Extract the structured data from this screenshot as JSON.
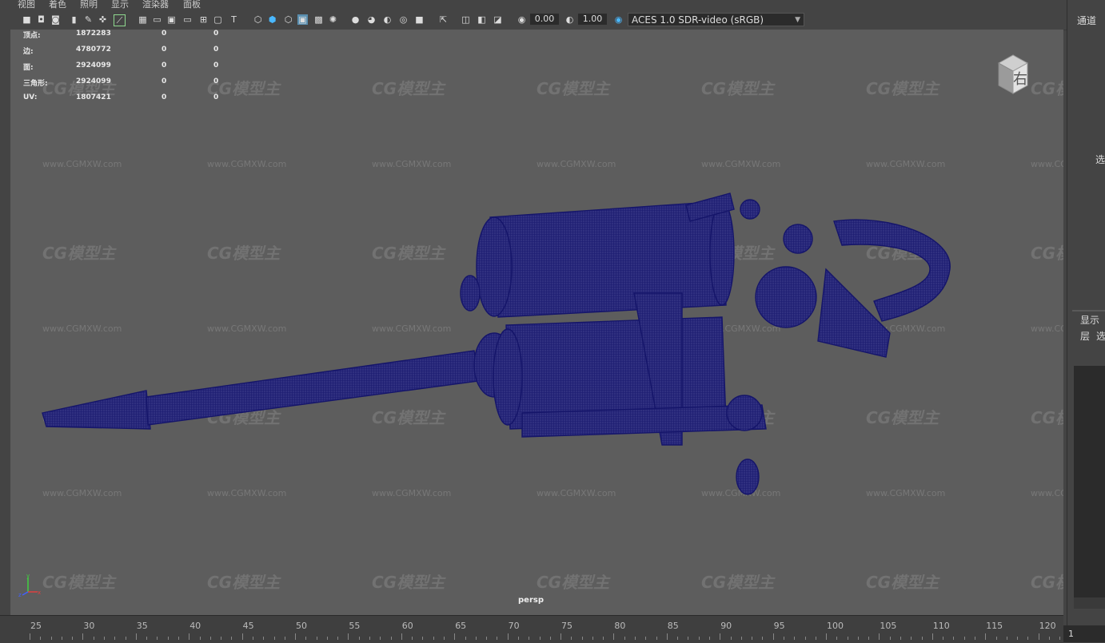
{
  "menu": [
    "视图",
    "着色",
    "照明",
    "显示",
    "渲染器",
    "面板"
  ],
  "toolbar": {
    "exposure_value": "0.00",
    "gamma_value": "1.00",
    "color_space": "ACES 1.0 SDR-video (sRGB)"
  },
  "hud_stats": [
    {
      "label": "顶点:",
      "v1": "1872283",
      "v2": "0",
      "v3": "0"
    },
    {
      "label": "边:",
      "v1": "4780772",
      "v2": "0",
      "v3": "0"
    },
    {
      "label": "面:",
      "v1": "2924099",
      "v2": "0",
      "v3": "0"
    },
    {
      "label": "三角形:",
      "v1": "2924099",
      "v2": "0",
      "v3": "0"
    },
    {
      "label": "UV:",
      "v1": "1807421",
      "v2": "0",
      "v3": "0"
    }
  ],
  "viewcube_label": "右",
  "camera_label": "persp",
  "watermark": {
    "logo": "CG模型主",
    "url": "www.CGMXW.com"
  },
  "right_panel": {
    "tab_channels": "通道",
    "select_label": "选",
    "display_label": "显示",
    "layer_label": "层",
    "sel2": "选"
  },
  "timeline": {
    "ticks": [
      "25",
      "30",
      "35",
      "40",
      "45",
      "50",
      "55",
      "60",
      "65",
      "70",
      "75",
      "80",
      "85",
      "90",
      "95",
      "100",
      "105",
      "110",
      "115",
      "120"
    ],
    "current_frame": "1"
  },
  "axis": {
    "x_color": "#e04040",
    "y_color": "#40d040",
    "z_color": "#4060ff"
  },
  "model_color": "#1a1a7a"
}
